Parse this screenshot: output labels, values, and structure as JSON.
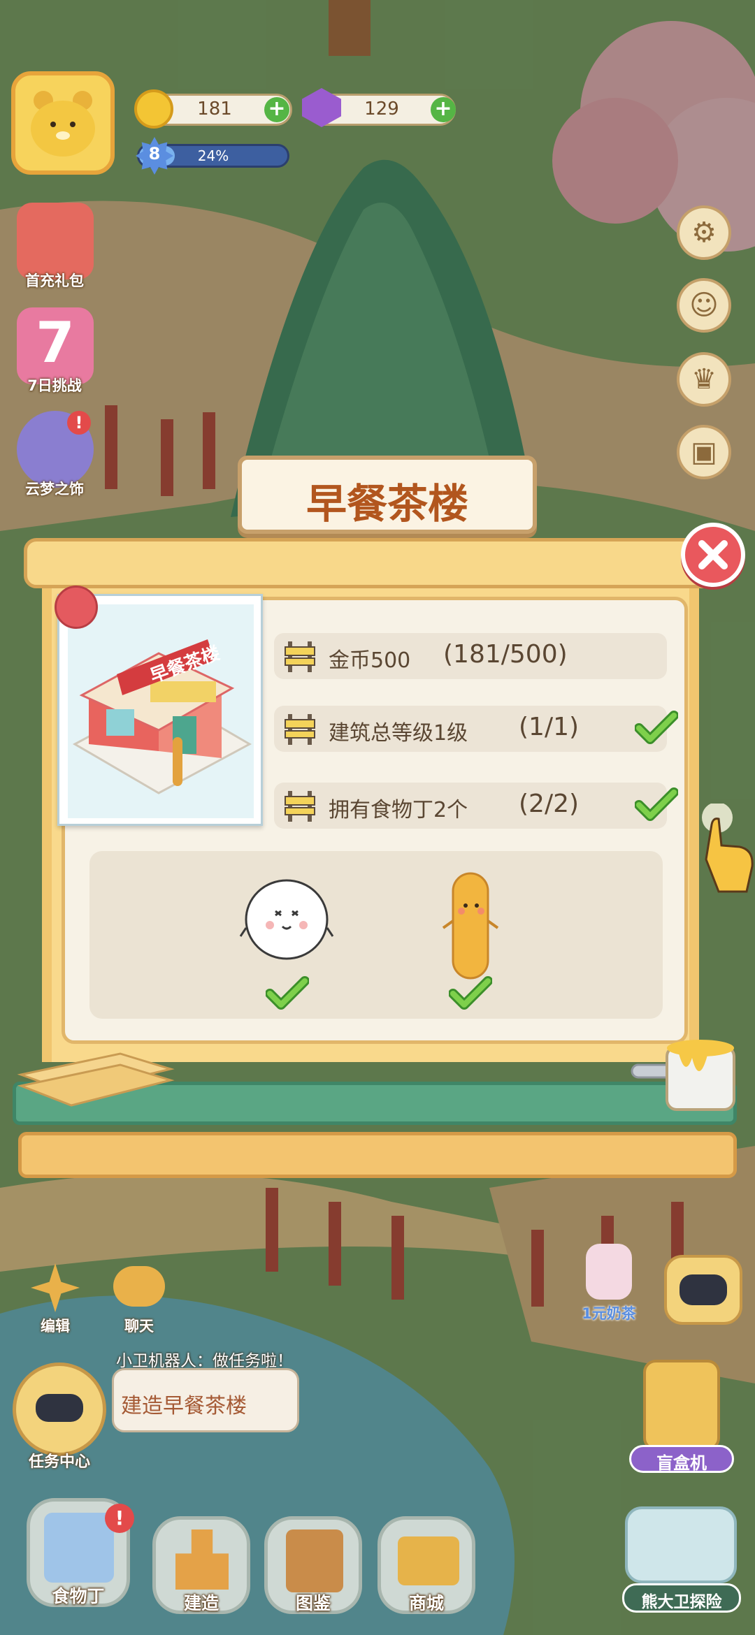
{
  "hud": {
    "coins": "181",
    "gems": "129",
    "level": "8",
    "progress_text": "24%",
    "progress": 0.24
  },
  "left_menu": [
    {
      "label": "首充礼包",
      "icon": "gift-pack-icon"
    },
    {
      "label": "7日挑战",
      "icon": "seven-day-icon"
    },
    {
      "label": "云梦之饰",
      "icon": "cloud-dream-icon"
    }
  ],
  "right_menu": [
    "settings-icon",
    "chat-face-icon",
    "trophy-icon",
    "backpack-icon"
  ],
  "dialog": {
    "title": "早餐茶楼",
    "building_sign": "早餐茶楼",
    "requirements": [
      {
        "label": "金币500",
        "count": "(181/500)",
        "done": false
      },
      {
        "label": "建筑总等级1级",
        "count": "(1/1)",
        "done": true
      },
      {
        "label": "拥有食物丁2个",
        "count": "(2/2)",
        "done": true
      }
    ],
    "foods": [
      {
        "name": "dumpling",
        "done": true
      },
      {
        "name": "fried-dough-stick",
        "done": true
      }
    ]
  },
  "lower_left": {
    "edit": "编辑",
    "chat": "聊天",
    "robot_line": "小卫机器人：做任务啦！",
    "task_bubble": "建造早餐茶楼",
    "task_center": "任务中心"
  },
  "lower_right": {
    "milk_tea": "1元奶茶",
    "blind_box": "盲盒机",
    "adventure": "熊大卫探险"
  },
  "bottom_nav": [
    {
      "label": "食物丁",
      "badge": "!"
    },
    {
      "label": "建造"
    },
    {
      "label": "图鉴"
    },
    {
      "label": "商城"
    }
  ]
}
